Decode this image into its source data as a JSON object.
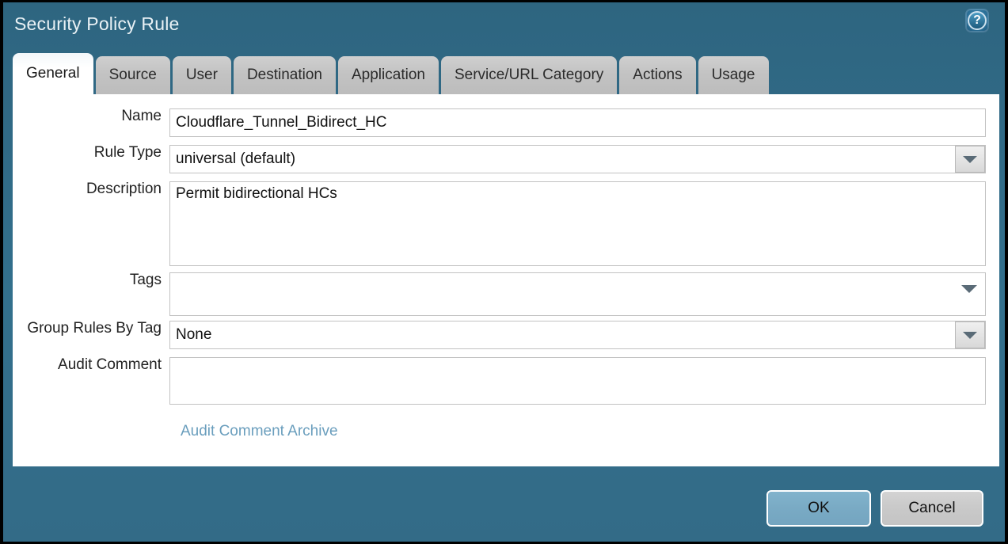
{
  "dialog": {
    "title": "Security Policy Rule",
    "help_icon": "help-question-icon"
  },
  "tabs": [
    {
      "label": "General",
      "active": true
    },
    {
      "label": "Source",
      "active": false
    },
    {
      "label": "User",
      "active": false
    },
    {
      "label": "Destination",
      "active": false
    },
    {
      "label": "Application",
      "active": false
    },
    {
      "label": "Service/URL Category",
      "active": false
    },
    {
      "label": "Actions",
      "active": false
    },
    {
      "label": "Usage",
      "active": false
    }
  ],
  "form": {
    "name": {
      "label": "Name",
      "value": "Cloudflare_Tunnel_Bidirect_HC",
      "placeholder": ""
    },
    "rule_type": {
      "label": "Rule Type",
      "value": "universal (default)",
      "placeholder": ""
    },
    "description": {
      "label": "Description",
      "value": "Permit bidirectional HCs",
      "placeholder": ""
    },
    "tags": {
      "label": "Tags",
      "value": "",
      "placeholder": ""
    },
    "group_rules_by_tag": {
      "label": "Group Rules By Tag",
      "value": "None",
      "placeholder": ""
    },
    "audit_comment": {
      "label": "Audit Comment",
      "value": "",
      "placeholder": ""
    },
    "archive_link": "Audit Comment Archive"
  },
  "footer": {
    "ok_label": "OK",
    "cancel_label": "Cancel"
  },
  "colors": {
    "dialog_blue": "#336b87",
    "panel_white": "#ffffff",
    "tab_inactive": "#c6c6c6",
    "link_blue": "#6a9ebd",
    "ok_blue": "#79aac4",
    "cancel_gray": "#c9c9c9"
  }
}
